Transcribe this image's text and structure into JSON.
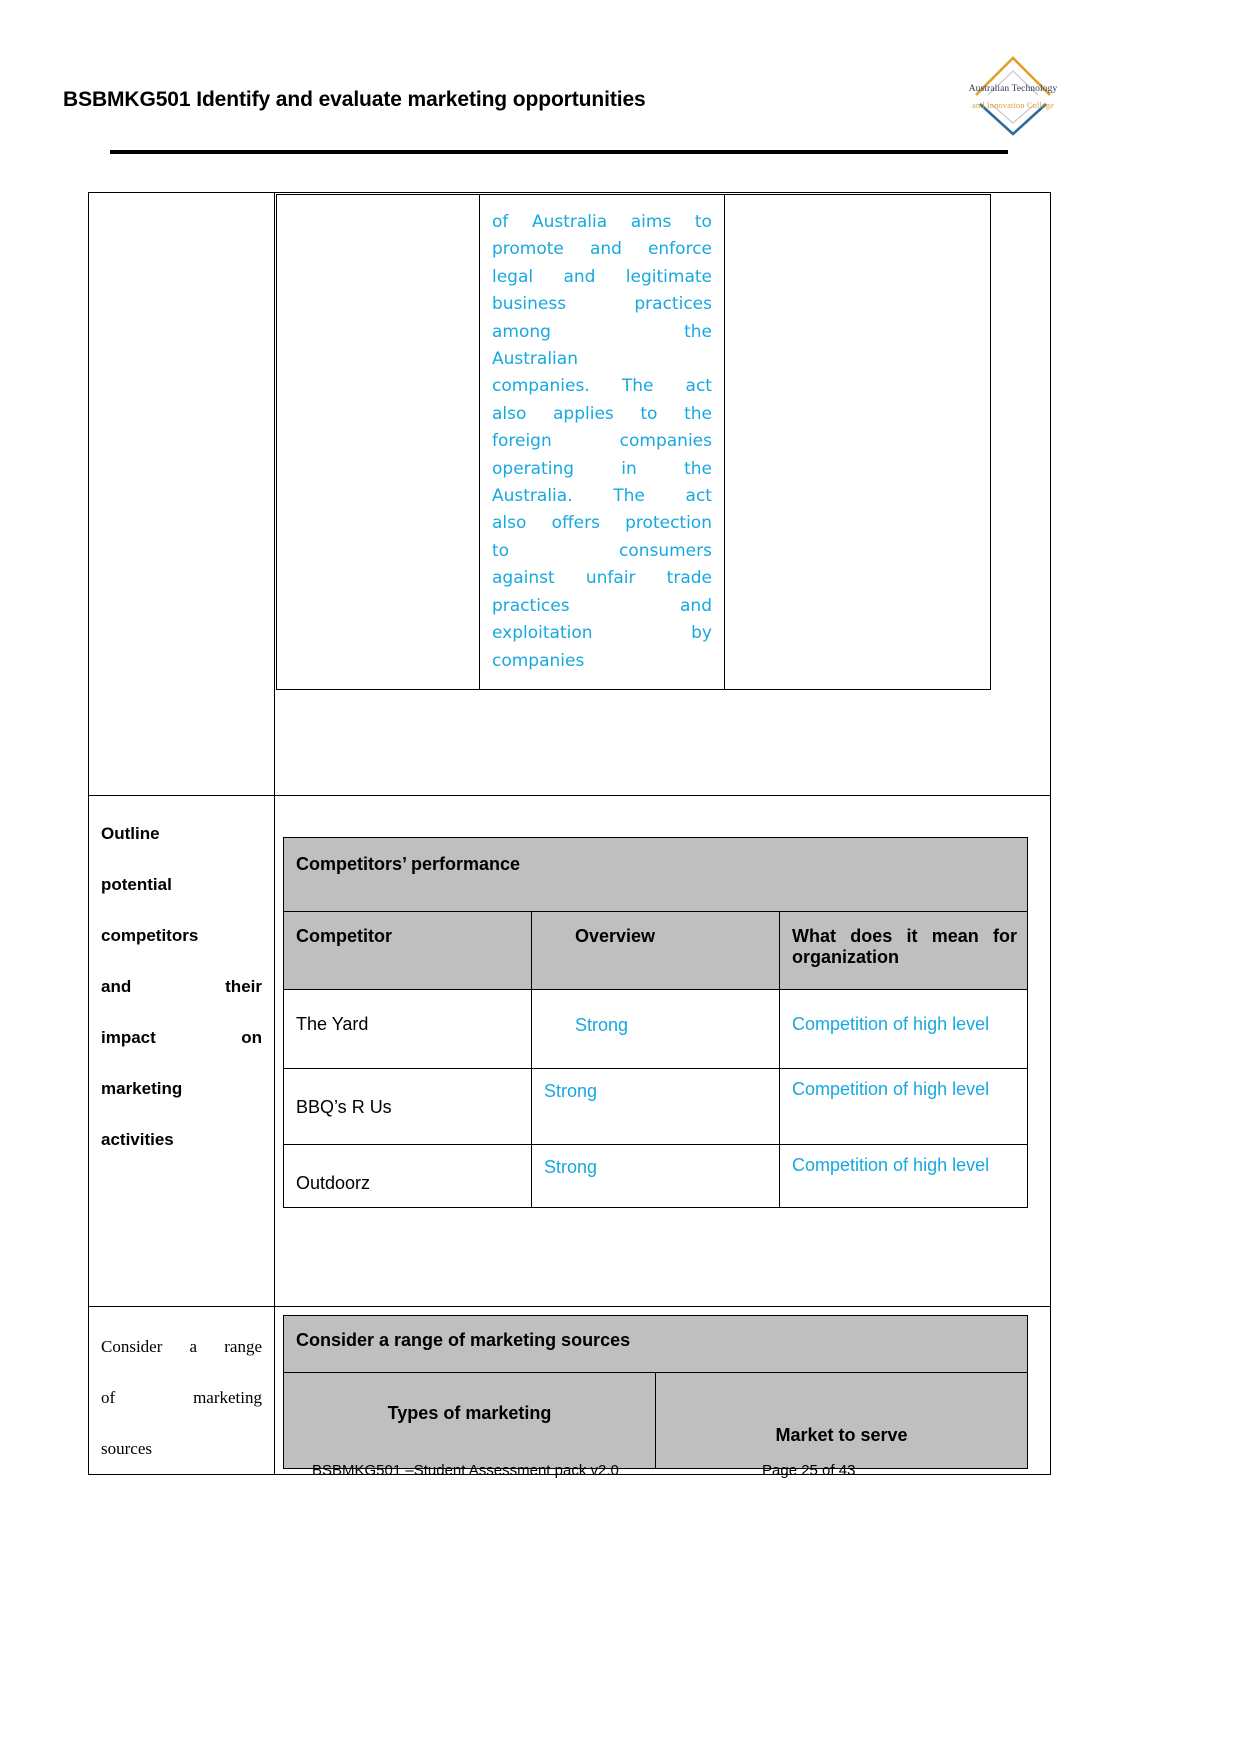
{
  "header": {
    "document_title": "BSBMKG501 Identify and evaluate marketing opportunities",
    "logo": {
      "name": "australian-technology-and-innovation-college-logo",
      "line1": "Australian Technology",
      "line2": "and Innovation College",
      "top_chevron_color": "#e0a030",
      "bottom_chevron_color": "#2f6b9a",
      "inner_line_color": "#b8b8b8"
    }
  },
  "top_section": {
    "blue_paragraph_lines": [
      [
        "of",
        "Australia",
        "aims",
        "to"
      ],
      [
        "promote",
        "and",
        "enforce"
      ],
      [
        "legal",
        "and",
        "legitimate"
      ],
      [
        "business",
        "practices"
      ],
      [
        "among",
        "the"
      ],
      [
        "Australian"
      ],
      [
        "companies.",
        "The",
        "act"
      ],
      [
        "also",
        "applies",
        "to",
        "the"
      ],
      [
        "foreign",
        "companies"
      ],
      [
        "operating",
        "in",
        "the"
      ],
      [
        "Australia.",
        "The",
        "act"
      ],
      [
        "also",
        "offers",
        "protection"
      ],
      [
        "to",
        "consumers"
      ],
      [
        "against",
        "unfair",
        "trade"
      ],
      [
        "practices",
        "and"
      ],
      [
        "exploitation",
        "by"
      ],
      [
        "companies"
      ]
    ],
    "blue_paragraph_text": "of Australia aims to promote and enforce legal and legitimate business practices among the Australian companies. The act also applies to the foreign companies operating in the Australia. The act also offers protection to consumers against unfair trade practices and exploitation by companies"
  },
  "competitors_section": {
    "left_label_lines": [
      "Outline",
      "potential",
      "competitors",
      "and their",
      "impact on",
      "marketing",
      "activities"
    ],
    "left_label_text": "Outline potential competitors and their impact on marketing activities",
    "table": {
      "title": "Competitors’ performance",
      "columns": [
        "Competitor",
        "Overview",
        "What does it mean for organization"
      ],
      "column3_line1": "What does it mean for",
      "column3_line2": "organization",
      "rows": [
        {
          "competitor": "The Yard",
          "overview": "Strong",
          "impact": "Competition of high level"
        },
        {
          "competitor": "BBQ’s R Us",
          "overview": "Strong",
          "impact": "Competition of high level"
        },
        {
          "competitor": "Outdoorz",
          "overview": "Strong",
          "impact": "Competition of high level"
        }
      ]
    }
  },
  "sources_section": {
    "left_label_lines": [
      "Consider a range",
      "of marketing",
      "sources"
    ],
    "left_label_text": "Consider a range of marketing sources",
    "table": {
      "title": "Consider a range of marketing sources",
      "columns": [
        "Types of marketing",
        "Market to serve"
      ]
    }
  },
  "footer": {
    "left": "BSBMKG501 –Student Assessment pack  v2.0",
    "right": "Page 25 of 43"
  },
  "colors": {
    "blue_text": "#17a8e0",
    "table_header_gray": "#bfbfbf",
    "border": "#000000"
  }
}
